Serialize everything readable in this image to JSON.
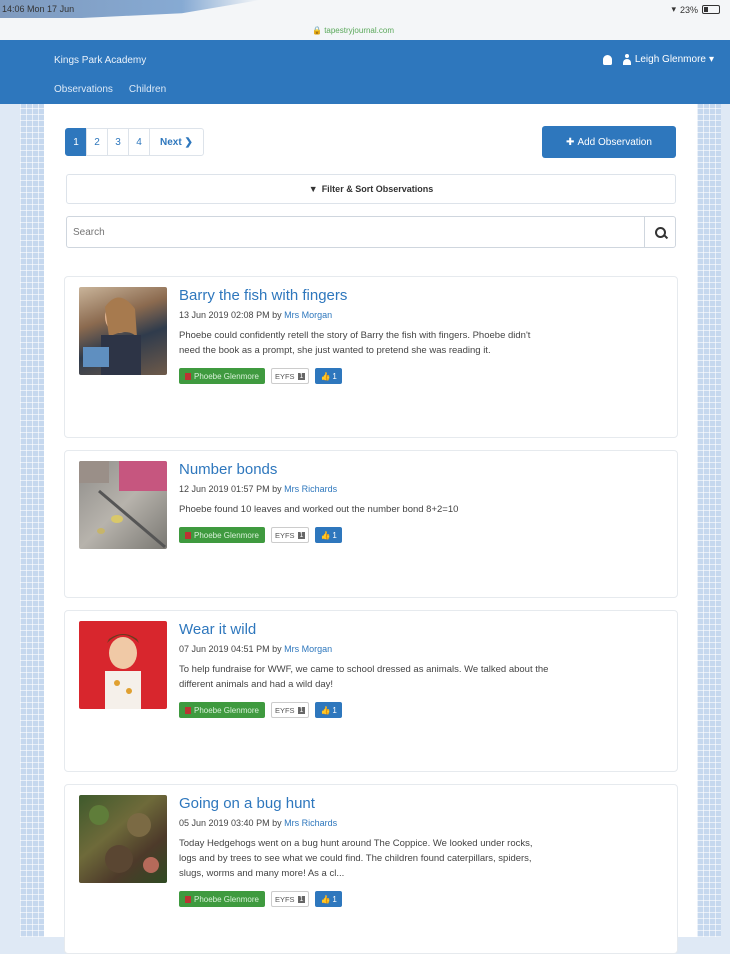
{
  "status_bar": {
    "time": "14:06",
    "date": "Mon 17 Jun",
    "battery": "23%"
  },
  "browser": {
    "url": "tapestryjournal.com"
  },
  "navbar": {
    "brand": "Kings Park Academy",
    "user": "Leigh Glenmore",
    "tabs": [
      "Observations",
      "Children"
    ]
  },
  "pager": {
    "pages": [
      "1",
      "2",
      "3",
      "4"
    ],
    "next": "Next ❯"
  },
  "actions": {
    "add_observation": "Add Observation",
    "filter": "Filter & Sort Observations"
  },
  "search": {
    "placeholder": "Search"
  },
  "observations": [
    {
      "title": "Barry the fish with fingers",
      "date": "13 Jun 2019 02:08 PM by",
      "author": "Mrs Morgan",
      "text": "Phoebe could confidently retell the story of Barry the fish with fingers. Phoebe didn't need the book as a prompt, she just wanted to pretend she was reading it.",
      "child": "Phoebe Glenmore",
      "eyfs": "EYFS",
      "eyfs_count": "1",
      "likes": "1"
    },
    {
      "title": "Number bonds",
      "date": "12 Jun 2019 01:57 PM by",
      "author": "Mrs Richards",
      "text": "Phoebe found 10 leaves and worked out the number bond 8+2=10",
      "child": "Phoebe Glenmore",
      "eyfs": "EYFS",
      "eyfs_count": "1",
      "likes": "1"
    },
    {
      "title": "Wear it wild",
      "date": "07 Jun 2019 04:51 PM by",
      "author": "Mrs Morgan",
      "text": "To help fundraise for WWF, we came to school dressed as animals. We talked about the different animals and had a wild day!",
      "child": "Phoebe Glenmore",
      "eyfs": "EYFS",
      "eyfs_count": "1",
      "likes": "1"
    },
    {
      "title": "Going on a bug hunt",
      "date": "05 Jun 2019 03:40 PM by",
      "author": "Mrs Richards",
      "text": "Today Hedgehogs went on a bug hunt around The Coppice. We looked under rocks, logs and by trees to see what we could find. The children found caterpillars, spiders, slugs, worms and many more! As a cl...",
      "child": "Phoebe Glenmore",
      "eyfs": "EYFS",
      "eyfs_count": "1",
      "likes": "1"
    }
  ],
  "colors": {
    "primary": "#2e77bd",
    "child_tag": "#3f9a3f",
    "accent_bg": "#dfe9f5"
  },
  "icons": {
    "bell": "bell-icon",
    "user": "user-icon",
    "search": "search-icon",
    "filter": "filter-icon",
    "plus": "plus-icon",
    "thumbs_up": "thumbs-up-icon"
  }
}
